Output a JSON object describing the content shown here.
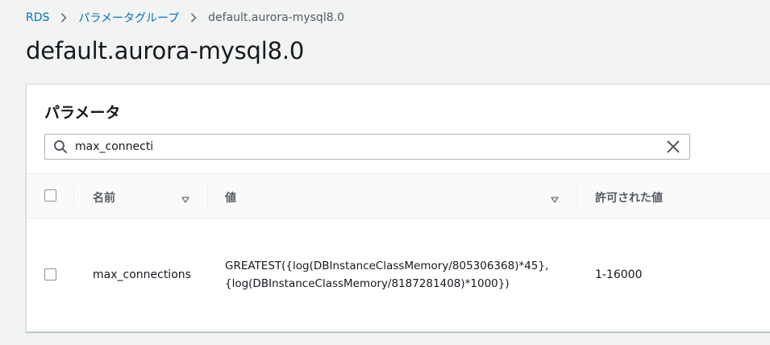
{
  "breadcrumb": {
    "root": "RDS",
    "parent": "パラメータグループ",
    "current": "default.aurora-mysql8.0"
  },
  "page": {
    "title": "default.aurora-mysql8.0"
  },
  "panel": {
    "title": "パラメータ",
    "search": {
      "value": "max_connecti"
    }
  },
  "table": {
    "columns": {
      "name": "名前",
      "value": "値",
      "allowed": "許可された値"
    },
    "rows": [
      {
        "name": "max_connections",
        "value_line1": "GREATEST({log(DBInstanceClassMemory/805306368)*45},",
        "value_line2": "{log(DBInstanceClassMemory/8187281408)*1000})",
        "allowed": "1-16000"
      }
    ]
  },
  "colors": {
    "link": "#0073bb",
    "background": "#f2f3f3",
    "text": "#16191f"
  }
}
